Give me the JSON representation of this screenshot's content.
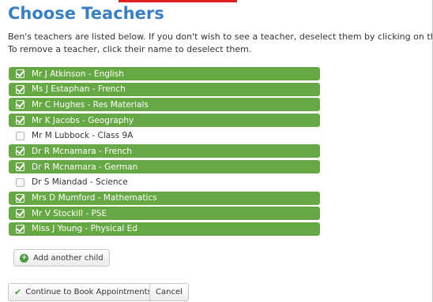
{
  "page": {
    "title": "Choose Teachers",
    "intro_line1": "Ben's teachers are listed below. If you don't wish to see a teacher, deselect them by clicking on the te",
    "intro_line2": "To remove a teacher, click their name to deselect them."
  },
  "teachers": [
    {
      "label": "Mr J Atkinson - English",
      "selected": true
    },
    {
      "label": "Ms J Estaphan - French",
      "selected": true
    },
    {
      "label": "Mr C Hughes - Res Materials",
      "selected": true
    },
    {
      "label": "Mr K Jacobs - Geography",
      "selected": true
    },
    {
      "label": "Mr M Lubbock - Class 9A",
      "selected": false
    },
    {
      "label": "Dr R Mcnamara - French",
      "selected": true
    },
    {
      "label": "Dr R Mcnamara - German",
      "selected": true
    },
    {
      "label": "Dr S Miandad - Science",
      "selected": false
    },
    {
      "label": "Mrs D Mumford - Mathematics",
      "selected": true
    },
    {
      "label": "Mr V Stockill - PSE",
      "selected": true
    },
    {
      "label": "Miss J Young - Physical Ed",
      "selected": true
    }
  ],
  "buttons": {
    "add_child": "Add another child",
    "continue": "Continue to Book Appointments",
    "cancel": "Cancel"
  },
  "colors": {
    "title": "#3a7fc2",
    "selected_row": "#66a844",
    "icon_green": "#4a9b3a"
  },
  "icons": {
    "add_child": "plus-circle-icon",
    "continue": "checkmark-icon",
    "row_checkbox": "checkbox-icon"
  }
}
